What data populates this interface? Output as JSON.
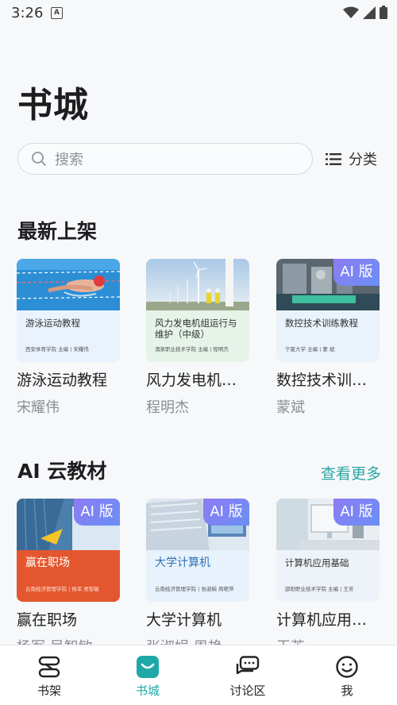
{
  "status": {
    "time": "3:26",
    "notif": "A"
  },
  "page": {
    "title": "书城"
  },
  "search": {
    "placeholder": "搜索"
  },
  "category": {
    "label": "分类"
  },
  "sections": {
    "latest": {
      "title": "最新上架",
      "books": [
        {
          "name": "游泳运动教程",
          "author": "宋耀伟",
          "cover_title": "游泳运动教程",
          "cover_meta": "西安体育学院   主编 | 宋耀伟",
          "ai": false
        },
        {
          "name": "风力发电机组...",
          "author": "程明杰",
          "cover_title": "风力发电机组运行与维护（中级）",
          "cover_meta": "酒泉职业技术学院   主编 | 程明杰",
          "ai": false
        },
        {
          "name": "数控技术训练...",
          "author": "蒙斌",
          "cover_title": "数控技术训练教程",
          "cover_meta": "宁夏大学   主编 | 蒙  斌",
          "ai": true,
          "badge": "AI 版"
        }
      ]
    },
    "ai": {
      "title": "AI 云教材",
      "more": "查看更多",
      "books": [
        {
          "name": "赢在职场",
          "author": "杨军 吴智敏",
          "cover_title": "赢在职场",
          "cover_meta": "云南经济管理学院 | 杨军 吴智敏",
          "badge": "AI 版"
        },
        {
          "name": "大学计算机",
          "author": "张淑娟 周艳",
          "cover_title": "大学计算机",
          "cover_meta": "云南经济管理学院 | 张淑娟 周艳萍",
          "badge": "AI 版"
        },
        {
          "name": "计算机应用基...",
          "author": "王芳",
          "cover_title": "计算机应用基础",
          "cover_meta": "邵阳职业技术学院   主编 | 王芳",
          "badge": "AI 版"
        }
      ]
    }
  },
  "nav": [
    {
      "label": "书架",
      "icon": "bookshelf-icon",
      "active": false
    },
    {
      "label": "书城",
      "icon": "bookstore-icon",
      "active": true
    },
    {
      "label": "讨论区",
      "icon": "discussion-icon",
      "active": false
    },
    {
      "label": "我",
      "icon": "smiley-icon",
      "active": false
    }
  ],
  "colors": {
    "accent": "#1fa8a8",
    "more_link": "#2ba6a4",
    "ai_badge": "#8c7cf2"
  }
}
